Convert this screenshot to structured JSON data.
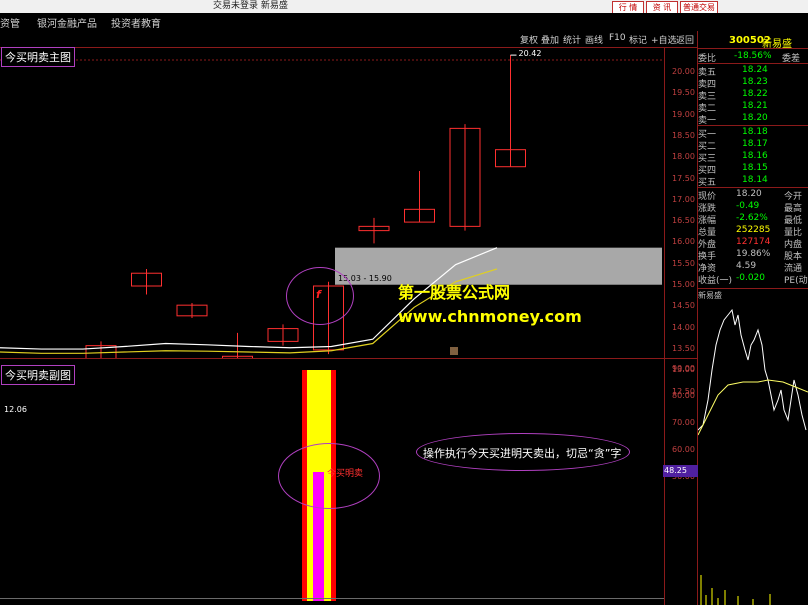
{
  "window": {
    "title": "交易未登录 新易盛",
    "buttons": [
      "行 情",
      "资 讯",
      "普通交易"
    ]
  },
  "menu": [
    "资管",
    "银河金融产品",
    "投资者教育"
  ],
  "toolbar": [
    "复权",
    "叠加",
    "统计",
    "画线",
    "F10",
    "标记",
    "+自选",
    "返回"
  ],
  "main_chart": {
    "label": "今买明卖主图",
    "y_ticks": [
      "20.00",
      "19.50",
      "19.00",
      "18.50",
      "18.00",
      "17.50",
      "17.00",
      "16.50",
      "16.00",
      "15.50",
      "15.00",
      "14.50",
      "14.00",
      "13.50",
      "13.00",
      "12.50"
    ],
    "high_label": "20.42",
    "low_label": "12.06",
    "zone_label": "15.03 - 15.90",
    "zone_top": 15.9,
    "zone_bottom": 15.03,
    "f_marker": "f"
  },
  "sub_chart": {
    "label": "今买明卖副图",
    "y_ticks": [
      "90.00",
      "80.00",
      "70.00",
      "60.00",
      "50.00"
    ],
    "current_value": "48.25",
    "bar_label": "今买明卖",
    "note": "操作执行今天买进明天卖出，切忌“贪”字"
  },
  "watermark": {
    "line1": "第一股票公式网",
    "line2": "www.chnmoney.com"
  },
  "chart_data": {
    "type": "candlestick",
    "candles": [
      {
        "open": 12.3,
        "close": 12.6,
        "high": 12.7,
        "low": 12.06
      },
      {
        "open": 12.6,
        "close": 12.75,
        "high": 12.8,
        "low": 12.5
      },
      {
        "open": 12.8,
        "close": 13.6,
        "high": 13.7,
        "low": 12.7
      },
      {
        "open": 15.0,
        "close": 15.3,
        "high": 15.4,
        "low": 14.8
      },
      {
        "open": 14.3,
        "close": 14.55,
        "high": 14.6,
        "low": 14.25
      },
      {
        "open": 13.3,
        "close": 13.35,
        "high": 13.9,
        "low": 13.1
      },
      {
        "open": 13.7,
        "close": 14.0,
        "high": 14.1,
        "low": 13.6
      },
      {
        "open": 13.5,
        "close": 15.0,
        "high": 15.1,
        "low": 13.4
      },
      {
        "open": 16.3,
        "close": 16.4,
        "high": 16.6,
        "low": 16.0
      },
      {
        "open": 16.5,
        "close": 16.8,
        "high": 17.7,
        "low": 16.5
      },
      {
        "open": 16.4,
        "close": 18.7,
        "high": 18.8,
        "low": 16.3
      },
      {
        "open": 17.8,
        "close": 18.2,
        "high": 20.42,
        "low": 17.8
      }
    ],
    "ma1": [
      13.55,
      13.52,
      13.52,
      13.58,
      13.65,
      13.62,
      13.58,
      13.55,
      13.58,
      13.75,
      14.7,
      15.5,
      15.9
    ],
    "ma2": [
      13.45,
      13.42,
      13.42,
      13.45,
      13.48,
      13.47,
      13.45,
      13.43,
      13.48,
      13.65,
      14.5,
      15.1,
      15.4
    ]
  },
  "quote": {
    "code": "300502",
    "name": "新易盛",
    "weibi_label": "委比",
    "weibi": "-18.56%",
    "weicha_label": "委差",
    "sells": [
      {
        "label": "卖五",
        "price": "18.24"
      },
      {
        "label": "卖四",
        "price": "18.23"
      },
      {
        "label": "卖三",
        "price": "18.22"
      },
      {
        "label": "卖二",
        "price": "18.21"
      },
      {
        "label": "卖一",
        "price": "18.20"
      }
    ],
    "buys": [
      {
        "label": "买一",
        "price": "18.18"
      },
      {
        "label": "买二",
        "price": "18.17"
      },
      {
        "label": "买三",
        "price": "18.16"
      },
      {
        "label": "买四",
        "price": "18.15"
      },
      {
        "label": "买五",
        "price": "18.14"
      }
    ],
    "stats": [
      {
        "l": "现价",
        "v": "18.20",
        "r": "今开"
      },
      {
        "l": "涨跌",
        "v": "-0.49",
        "r": "最高"
      },
      {
        "l": "涨幅",
        "v": "-2.62%",
        "r": "最低"
      },
      {
        "l": "总量",
        "v": "252285",
        "r": "量比"
      },
      {
        "l": "外盘",
        "v": "127174",
        "r": "内盘"
      },
      {
        "l": "换手",
        "v": "19.86%",
        "r": "股本"
      },
      {
        "l": "净资",
        "v": "4.59",
        "r": "流通"
      },
      {
        "l": "收益(一)",
        "v": "-0.020",
        "r": "PE(动)"
      }
    ],
    "mini_label": "新易盛"
  },
  "colors": {
    "up": "#ff3030",
    "down": "#00ffff",
    "grid": "#8b1a1a",
    "sub_yellow": "#ffff00",
    "sub_red": "#ff0000",
    "sub_magenta": "#ff00ff"
  }
}
